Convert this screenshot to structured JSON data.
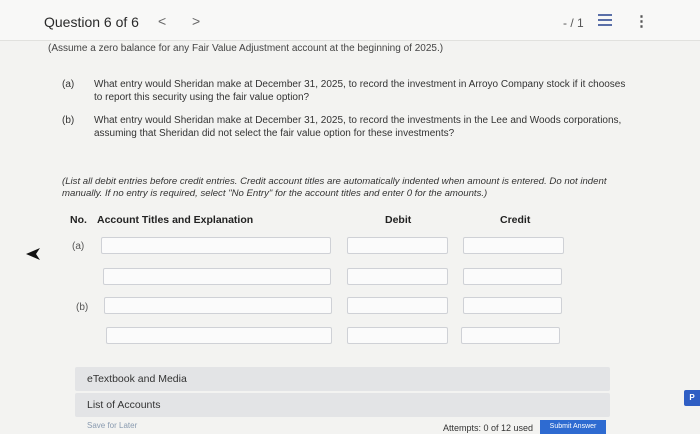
{
  "header": {
    "title": "Question 6 of 6",
    "prev_glyph": "<",
    "next_glyph": ">",
    "score": "- / 1"
  },
  "question": {
    "cutoff_text": "(Assume a zero balance for any Fair Value Adjustment account at the beginning of 2025.)",
    "parts": [
      {
        "label": "(a)",
        "text": "What entry would Sheridan make at December 31, 2025, to record the investment in Arroyo Company stock if it chooses to report this security using the fair value option?"
      },
      {
        "label": "(b)",
        "text": "What entry would Sheridan make at December 31, 2025, to record the investments in the Lee and Woods corporations, assuming that Sheridan did not select the fair value option for these investments?"
      }
    ],
    "instructions": "(List all debit entries before credit entries. Credit account titles are automatically indented when amount is entered. Do not indent manually. If no entry is required, select \"No Entry\" for the account titles and enter 0 for the amounts.)"
  },
  "table": {
    "col_no": "No.",
    "col_account": "Account Titles and Explanation",
    "col_debit": "Debit",
    "col_credit": "Credit",
    "row_a": "(a)",
    "row_b": "(b)"
  },
  "resources": {
    "etextbook": "eTextbook and Media",
    "list_of_accounts": "List of Accounts"
  },
  "footer": {
    "save": "Save for Later",
    "attempts": "Attempts: 0 of 12 used",
    "submit": "Submit Answer"
  },
  "side_badge": "P"
}
